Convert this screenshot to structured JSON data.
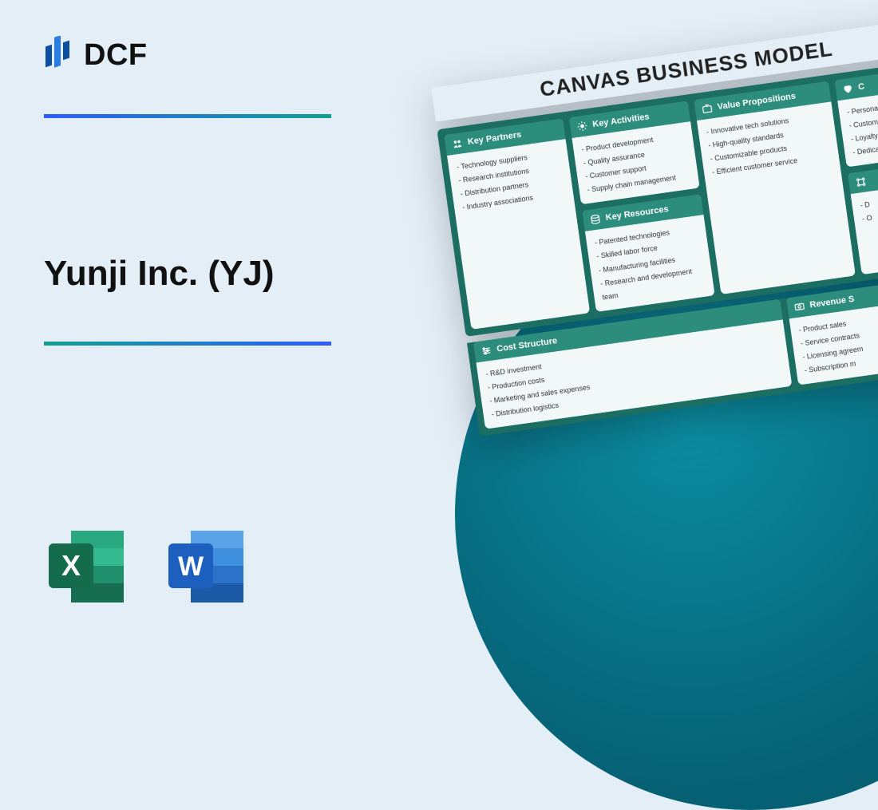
{
  "brand": "DCF",
  "page_title": "Yunji Inc. (YJ)",
  "file_icons": [
    "excel",
    "word"
  ],
  "canvas": {
    "heading": "CANVAS BUSINESS MODEL",
    "sections": {
      "key_partners": {
        "label": "Key Partners",
        "items": [
          "Technology suppliers",
          "Research institutions",
          "Distribution partners",
          "Industry associations"
        ]
      },
      "key_activities": {
        "label": "Key Activities",
        "items": [
          "Product development",
          "Quality assurance",
          "Customer support",
          "Supply chain management"
        ]
      },
      "key_resources": {
        "label": "Key Resources",
        "items": [
          "Patented technologies",
          "Skilled labor force",
          "Manufacturing facilities",
          "Research and development team"
        ]
      },
      "value_propositions": {
        "label": "Value Propositions",
        "items": [
          "Innovative tech solutions",
          "High-quality standards",
          "Customizable products",
          "Efficient customer service"
        ]
      },
      "customer_relationships": {
        "label": "C",
        "items": [
          "Personaliz",
          "Customer",
          "Loyalty p",
          "Dedica"
        ]
      },
      "channels": {
        "label": "",
        "items": [
          "D",
          "O"
        ]
      },
      "cost_structure": {
        "label": "Cost Structure",
        "items": [
          "R&D investment",
          "Production costs",
          "Marketing and sales expenses",
          "Distribution logistics"
        ]
      },
      "revenue_streams": {
        "label": "Revenue S",
        "items": [
          "Product sales",
          "Service contracts",
          "Licensing agreem",
          "Subscription m"
        ]
      }
    }
  }
}
